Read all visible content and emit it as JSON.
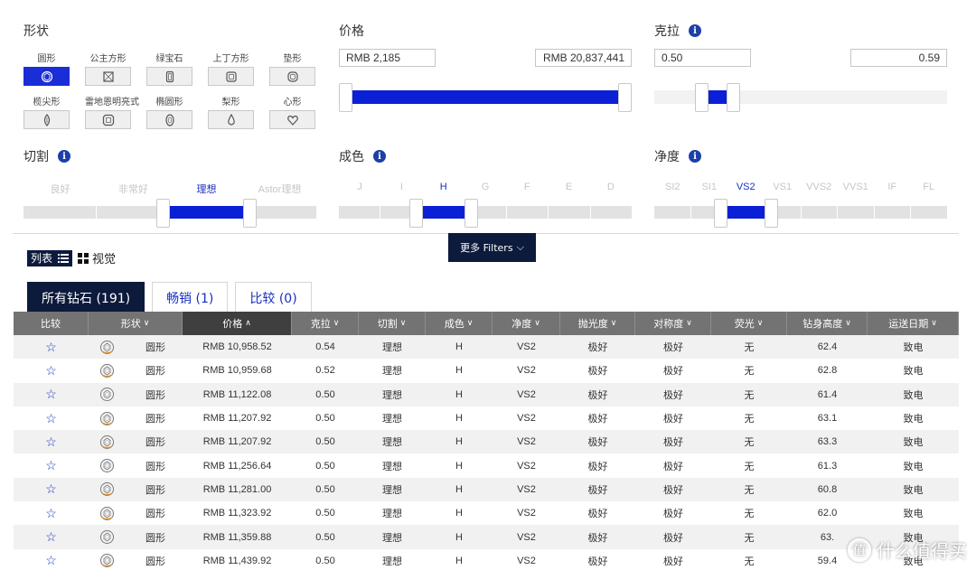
{
  "shape": {
    "title": "形状",
    "items": [
      {
        "label": "圆形",
        "icon": "round-icon",
        "active": true
      },
      {
        "label": "公主方形",
        "icon": "princess-icon",
        "active": false
      },
      {
        "label": "绿宝石",
        "icon": "emerald-icon",
        "active": false
      },
      {
        "label": "上丁方形",
        "icon": "asscher-icon",
        "active": false
      },
      {
        "label": "垫形",
        "icon": "cushion-icon",
        "active": false
      },
      {
        "label": "榄尖形",
        "icon": "marquise-icon",
        "active": false
      },
      {
        "label": "雷地恩明亮式",
        "icon": "radiant-icon",
        "active": false
      },
      {
        "label": "椭圆形",
        "icon": "oval-icon",
        "active": false
      },
      {
        "label": "梨形",
        "icon": "pear-icon",
        "active": false
      },
      {
        "label": "心形",
        "icon": "heart-icon",
        "active": false
      }
    ]
  },
  "price": {
    "title": "价格",
    "min": "RMB 2,185",
    "max": "RMB 20,837,441",
    "range_fraction": [
      0.0,
      1.0
    ]
  },
  "carat": {
    "title": "克拉",
    "min": "0.50",
    "max": "0.59",
    "info": "i",
    "range_fraction": [
      0.14,
      0.2
    ]
  },
  "cut": {
    "title": "切割",
    "info": "i",
    "grades": [
      "良好",
      "非常好",
      "理想",
      "Astor理想"
    ],
    "selected": "理想"
  },
  "color": {
    "title": "成色",
    "info": "i",
    "grades": [
      "J",
      "I",
      "H",
      "G",
      "F",
      "E",
      "D"
    ],
    "selected": "H"
  },
  "clarity": {
    "title": "净度",
    "info": "i",
    "grades": [
      "SI2",
      "SI1",
      "VS2",
      "VS1",
      "VVS2",
      "VVS1",
      "IF",
      "FL"
    ],
    "selected": "VS2"
  },
  "more_filters": "更多 Filters",
  "view": {
    "list": "列表",
    "visual": "视觉"
  },
  "tabs": [
    {
      "label": "所有钻石 (191)",
      "active": true
    },
    {
      "label": "畅销 (1)",
      "active": false
    },
    {
      "label": "比较 (0)",
      "active": false
    }
  ],
  "table": {
    "headers": [
      "比较",
      "形状",
      "价格",
      "克拉",
      "切割",
      "成色",
      "净度",
      "抛光度",
      "对称度",
      "荧光",
      "钻身高度",
      "运送日期"
    ],
    "rows": [
      {
        "shape": "圆形",
        "price": "RMB 10,958.52",
        "carat": "0.54",
        "cut": "理想",
        "color": "H",
        "clarity": "VS2",
        "polish": "极好",
        "symmetry": "极好",
        "fluor": "无",
        "depth": "62.4",
        "ship": "致电"
      },
      {
        "shape": "圆形",
        "price": "RMB 10,959.68",
        "carat": "0.52",
        "cut": "理想",
        "color": "H",
        "clarity": "VS2",
        "polish": "极好",
        "symmetry": "极好",
        "fluor": "无",
        "depth": "62.8",
        "ship": "致电"
      },
      {
        "shape": "圆形",
        "price": "RMB 11,122.08",
        "carat": "0.50",
        "cut": "理想",
        "color": "H",
        "clarity": "VS2",
        "polish": "极好",
        "symmetry": "极好",
        "fluor": "无",
        "depth": "61.4",
        "ship": "致电"
      },
      {
        "shape": "圆形",
        "price": "RMB 11,207.92",
        "carat": "0.50",
        "cut": "理想",
        "color": "H",
        "clarity": "VS2",
        "polish": "极好",
        "symmetry": "极好",
        "fluor": "无",
        "depth": "63.1",
        "ship": "致电"
      },
      {
        "shape": "圆形",
        "price": "RMB 11,207.92",
        "carat": "0.50",
        "cut": "理想",
        "color": "H",
        "clarity": "VS2",
        "polish": "极好",
        "symmetry": "极好",
        "fluor": "无",
        "depth": "63.3",
        "ship": "致电"
      },
      {
        "shape": "圆形",
        "price": "RMB 11,256.64",
        "carat": "0.50",
        "cut": "理想",
        "color": "H",
        "clarity": "VS2",
        "polish": "极好",
        "symmetry": "极好",
        "fluor": "无",
        "depth": "61.3",
        "ship": "致电"
      },
      {
        "shape": "圆形",
        "price": "RMB 11,281.00",
        "carat": "0.50",
        "cut": "理想",
        "color": "H",
        "clarity": "VS2",
        "polish": "极好",
        "symmetry": "极好",
        "fluor": "无",
        "depth": "60.8",
        "ship": "致电"
      },
      {
        "shape": "圆形",
        "price": "RMB 11,323.92",
        "carat": "0.50",
        "cut": "理想",
        "color": "H",
        "clarity": "VS2",
        "polish": "极好",
        "symmetry": "极好",
        "fluor": "无",
        "depth": "62.0",
        "ship": "致电"
      },
      {
        "shape": "圆形",
        "price": "RMB 11,359.88",
        "carat": "0.50",
        "cut": "理想",
        "color": "H",
        "clarity": "VS2",
        "polish": "极好",
        "symmetry": "极好",
        "fluor": "无",
        "depth": "63.",
        "ship": "致电"
      },
      {
        "shape": "圆形",
        "price": "RMB 11,439.92",
        "carat": "0.50",
        "cut": "理想",
        "color": "H",
        "clarity": "VS2",
        "polish": "极好",
        "symmetry": "极好",
        "fluor": "无",
        "depth": "59.4",
        "ship": "致电"
      }
    ]
  },
  "watermark": {
    "glyph": "值",
    "text": "什么值得买"
  },
  "colors": {
    "accent": "#0a1fd6",
    "navy": "#0c1a3c",
    "header": "#737373"
  }
}
